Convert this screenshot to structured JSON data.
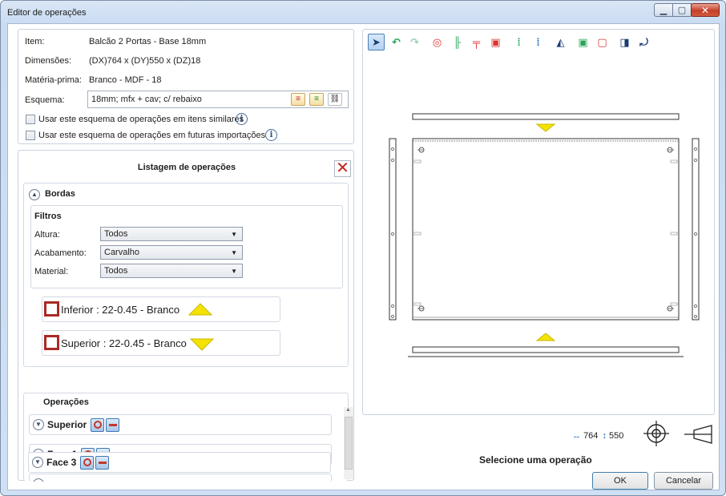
{
  "window": {
    "title": "Editor de operações"
  },
  "item": {
    "item_label": "Item:",
    "item_value": "Balcão 2 Portas - Base 18mm",
    "dim_label": "Dimensões:",
    "dim_value": "(DX)764 x (DY)550 x (DZ)18",
    "mat_label": "Matéria-prima:",
    "mat_value": "Branco - MDF - 18",
    "scheme_label": "Esquema:",
    "scheme_value": "18mm; mfx + cav; c/ rebaixo",
    "check_similar": "Usar este esquema de operações em itens similares",
    "check_future": "Usar este esquema de operações em futuras importações"
  },
  "list": {
    "title": "Listagem de operações",
    "bordas": {
      "title": "Bordas",
      "filters_title": "Filtros",
      "altura_label": "Altura:",
      "altura_value": "Todos",
      "acabamento_label": "Acabamento:",
      "acabamento_value": "Carvalho",
      "material_label": "Material:",
      "material_value": "Todos",
      "edges": [
        {
          "label": "Inferior : 22-0.45 - Branco"
        },
        {
          "label": "Superior : 22-0.45 - Branco"
        }
      ]
    },
    "operacoes": {
      "title": "Operações",
      "rows": [
        {
          "label": "Superior"
        },
        {
          "label": "Face 1"
        },
        {
          "label": "Face 3"
        }
      ]
    }
  },
  "viewer": {
    "dim_x": "764",
    "dim_y": "550",
    "status": "Selecione uma operação"
  },
  "buttons": {
    "ok": "OK",
    "cancel": "Cancelar"
  },
  "colors": {
    "edge_marker": "#f4e200",
    "accent_red": "#a82a25",
    "accent_blue": "#3f77b3"
  }
}
